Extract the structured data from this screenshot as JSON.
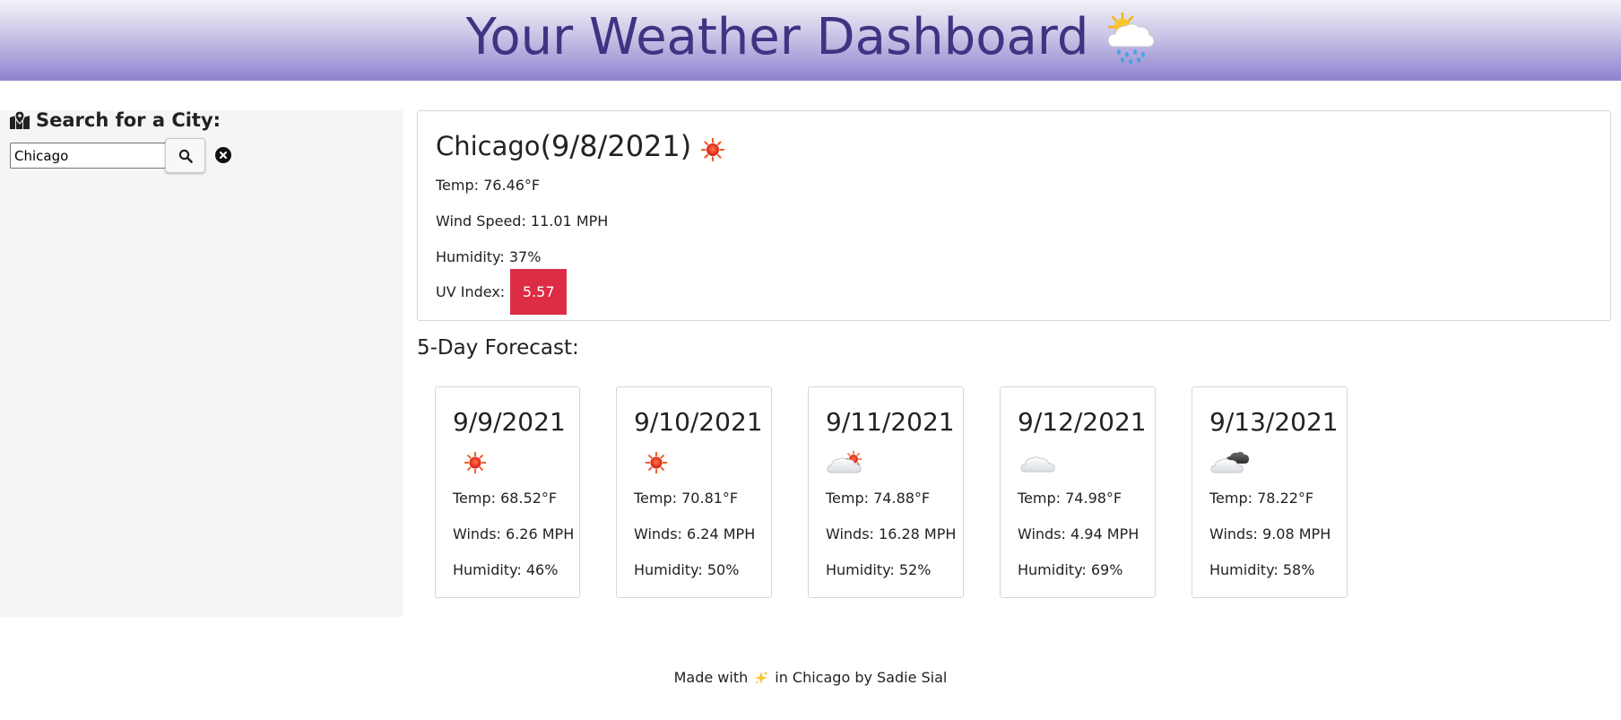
{
  "header": {
    "title": "Your Weather Dashboard",
    "icon": "sun-behind-rain-cloud-icon"
  },
  "search": {
    "label": "Search for a City:",
    "label_icon": "map-marked-icon",
    "input_value": "Chicago",
    "search_icon": "search-icon",
    "clear_icon": "close-circle-icon"
  },
  "current": {
    "city": "Chicago",
    "date": "(9/8/2021)",
    "icon": "sun-icon",
    "temp": "Temp: 76.46°F",
    "wind": "Wind Speed: 11.01 MPH",
    "humidity": "Humidity: 37%",
    "uv_label": "UV Index:",
    "uv_value": "5.57",
    "uv_color": "#dc2d45"
  },
  "forecast": {
    "heading": "5-Day Forecast:",
    "days": [
      {
        "date": "9/9/2021",
        "icon": "sun-icon",
        "temp": "Temp: 68.52°F",
        "wind": "Winds: 6.26 MPH",
        "humidity": "Humidity: 46%"
      },
      {
        "date": "9/10/2021",
        "icon": "sun-icon",
        "temp": "Temp: 70.81°F",
        "wind": "Winds: 6.24 MPH",
        "humidity": "Humidity: 50%"
      },
      {
        "date": "9/11/2021",
        "icon": "cloud-sun-icon",
        "temp": "Temp: 74.88°F",
        "wind": "Winds: 16.28 MPH",
        "humidity": "Humidity: 52%"
      },
      {
        "date": "9/12/2021",
        "icon": "cloud-icon",
        "temp": "Temp: 74.98°F",
        "wind": "Winds: 4.94 MPH",
        "humidity": "Humidity: 69%"
      },
      {
        "date": "9/13/2021",
        "icon": "dark-clouds-icon",
        "temp": "Temp: 78.22°F",
        "wind": "Winds: 9.08 MPH",
        "humidity": "Humidity: 58%"
      }
    ]
  },
  "footer": {
    "before": "Made with",
    "icon": "sparkles-icon",
    "after": "in Chicago by Sadie Sial"
  }
}
